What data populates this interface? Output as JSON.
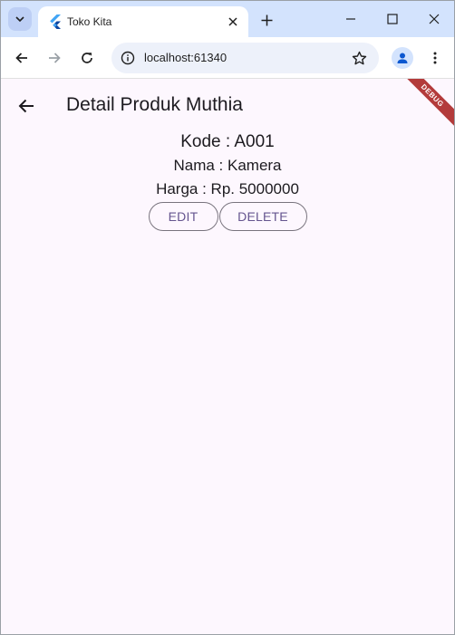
{
  "browser": {
    "tab_title": "Toko Kita",
    "url": "localhost:61340"
  },
  "icons": {
    "tab_search": "chevron-down-icon",
    "favicon": "flutter-icon",
    "tab_close": "close-icon",
    "new_tab": "plus-icon",
    "minimize": "minimize-icon",
    "maximize": "maximize-icon",
    "close_window": "close-icon",
    "back": "arrow-left-icon",
    "forward": "arrow-right-icon",
    "reload": "reload-icon",
    "site_info": "info-icon",
    "bookmark": "star-icon",
    "profile": "person-icon",
    "menu": "more-vert-icon"
  },
  "app": {
    "title": "Detail Produk Muthia",
    "kode": "Kode : A001",
    "nama": "Nama : Kamera",
    "harga": "Harga : Rp. 5000000",
    "edit_label": "EDIT",
    "delete_label": "DELETE",
    "debug_banner": "DEBUG"
  },
  "colors": {
    "tabstrip_bg": "#d3e3fd",
    "app_bg": "#fdf7fe",
    "button_text": "#65558f",
    "button_border": "#79747e",
    "debug_ribbon": "#b33b3b"
  }
}
